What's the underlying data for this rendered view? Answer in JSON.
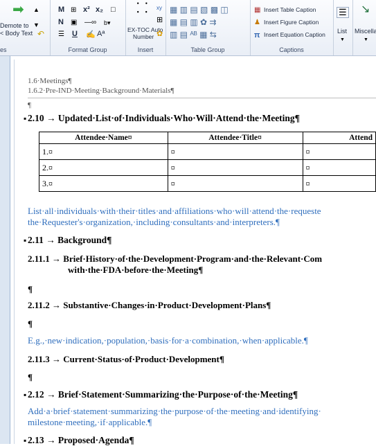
{
  "ribbon": {
    "promote_group": {
      "demote_label": "Demote to",
      "body_text_label": "< Body Text",
      "group_label": "es"
    },
    "format_group": {
      "label": "Format Group",
      "items": [
        "M",
        "N",
        "x²",
        "x₂",
        "U",
        "Aª"
      ]
    },
    "insert_group": {
      "label": "Insert",
      "extoc_label": "EX-TOC Auto",
      "number_label": "Number"
    },
    "table_group": {
      "label": "Table Group"
    },
    "captions_group": {
      "label": "Captions",
      "insert_table_caption": "Insert Table Caption",
      "insert_figure_caption": "Insert Figure Caption",
      "insert_equation_caption": "Insert Equation Caption"
    },
    "list": {
      "label": "List"
    },
    "misc": {
      "label": "Miscella"
    }
  },
  "document": {
    "breadcrumb_1": "1.6·Meetings¶",
    "breadcrumb_2": "1.6.2·Pre-IND·Meeting·Background·Materials¶",
    "pilcrow": "¶",
    "section_210": "2.10 → Updated·List·of·Individuals·Who·Will·Attend·the·Meeting¶",
    "table": {
      "headers": [
        "Attendee·Name¤",
        "Attendee·Title¤",
        "Attend"
      ],
      "rows": [
        [
          "1.¤",
          "¤",
          "¤"
        ],
        [
          "2.¤",
          "¤",
          "¤"
        ],
        [
          "3.¤",
          "¤",
          "¤"
        ]
      ]
    },
    "note_210_line1": "List·all·individuals·with·their·titles·and·affiliations·who·will·attend·the·requeste",
    "note_210_line2": "the·Requester's·organization,·including·consultants·and·interpreters.¶",
    "section_211": "2.11 → Background¶",
    "section_2111_line1": "2.11.1 → Brief·History·of·the·Development·Program·and·the·Relevant·Com",
    "section_2111_line2": "with·the·FDA·before·the·Meeting¶",
    "section_2112": "2.11.2 → Substantive·Changes·in·Product·Development·Plans¶",
    "note_2112": "E.g.,·new·indication,·population,·basis·for·a·combination,·when·applicable.¶",
    "section_2113": "2.11.3 → Current·Status·of·Product·Development¶",
    "section_212": "2.12 → Brief·Statement·Summarizing·the·Purpose·of·the·Meeting¶",
    "note_212_line1": "Add·a·brief·statement·summarizing·the·purpose·of·the·meeting·and·identifying·",
    "note_212_line2": "milestone·meeting,·if·applicable.¶",
    "section_213": "2.13 → Proposed·Agenda¶"
  }
}
